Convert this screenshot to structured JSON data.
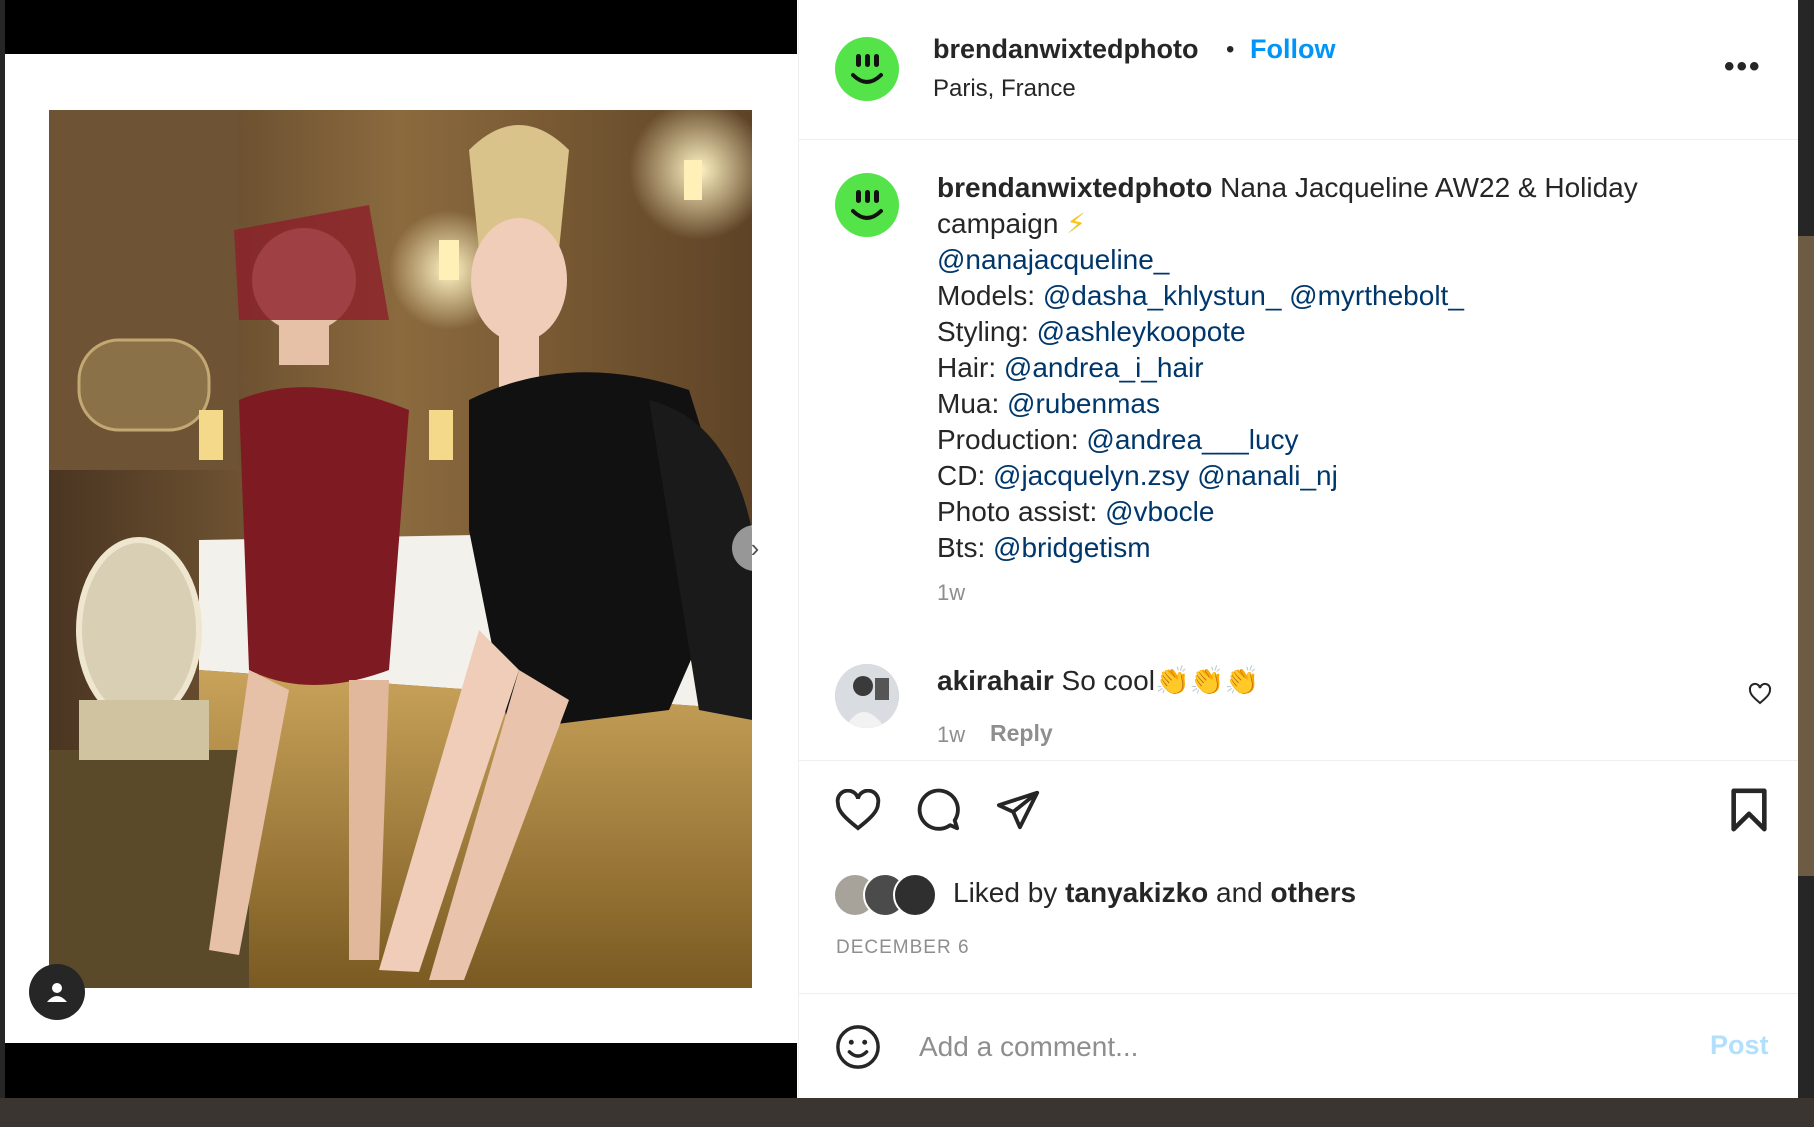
{
  "post": {
    "username": "brendanwixtedphoto",
    "separator": "•",
    "follow_label": "Follow",
    "location": "Paris, France",
    "more_label": "•••"
  },
  "caption": {
    "username": "brendanwixtedphoto",
    "title": "Nana Jacqueline AW22 & Holiday campaign",
    "emoji": "⚡",
    "brand_mention": "@nanajacqueline_",
    "lines": [
      {
        "label": "Models:",
        "mentions": "@dasha_khlystun_ @myrthebolt_"
      },
      {
        "label": "Styling:",
        "mentions": "@ashleykoopote"
      },
      {
        "label": "Hair:",
        "mentions": "@andrea_i_hair"
      },
      {
        "label": "Mua:",
        "mentions": "@rubenmas"
      },
      {
        "label": "Production:",
        "mentions": "@andrea___lucy"
      },
      {
        "label": "CD:",
        "mentions": "@jacquelyn.zsy @nanali_nj"
      },
      {
        "label": "Photo assist:",
        "mentions": "@vbocle"
      },
      {
        "label": "Bts:",
        "mentions": "@bridgetism"
      }
    ],
    "time": "1w"
  },
  "comment": {
    "username": "akirahair",
    "text": "So cool",
    "emojis": "👏👏👏",
    "time": "1w",
    "reply_label": "Reply"
  },
  "likes": {
    "prefix": "Liked by",
    "user": "tanyakizko",
    "conjunction": "and",
    "others": "others"
  },
  "date": "DECEMBER 6",
  "add_comment": {
    "placeholder": "Add a comment...",
    "post_label": "Post"
  },
  "colors": {
    "accent": "#0095f6",
    "mention": "#00376b",
    "avatar_green": "#55e34a",
    "muted": "#8e8e8e"
  }
}
